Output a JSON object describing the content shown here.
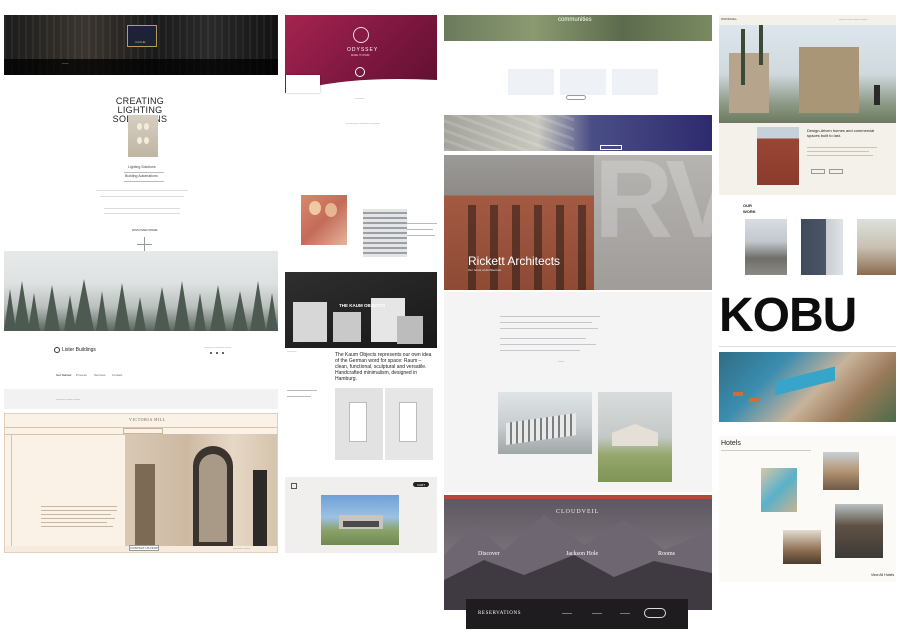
{
  "col1": {
    "cache_label": "CACHE",
    "headline": "CREATING LIGHTING SOLUTIONS",
    "menu": [
      "Lighting Solutions",
      "Building Automations"
    ],
    "discover": "DISCOVER MORE",
    "lister_name": "Lister Buildings",
    "lister_nav": [
      "Get Started",
      "Process",
      "Services",
      "Contact"
    ],
    "victoria_title": "VICTORIA HILL",
    "victoria_btn": "CONTACT US NOW"
  },
  "col2": {
    "odyssey_title": "ODYSSEY",
    "odyssey_sub": "MAKE IT CHAIR",
    "kaum_title": "THE KAUM OBJECTS",
    "kaum_text": "The Kaum Objects represents our own idea of the German word for space: Raum – clean, functional, sculptural and versatile. Handcrafted minimalism, designed in Hamburg.",
    "bottom_btn": "CART"
  },
  "col3": {
    "communities": "communities",
    "rickett_title": "Rickett Architects",
    "rickett_sub": "Our home of Architecture",
    "rv_mark": "RV",
    "cloudveil": "CLOUDVEIL",
    "places": [
      "Discover",
      "Jackson Hole",
      "Rooms"
    ],
    "reservations": "RESERVATIONS"
  },
  "col4": {
    "woodhill": "WOODHILL",
    "headline": "Design-driven homes and commercial spaces built to last.",
    "our_work": "OUR WORK",
    "kobu": "KOBU",
    "hotels": "Hotels",
    "view_all": "View All Hotels"
  },
  "colors": {
    "odyssey": "#8a1b43",
    "rickett_red": "#b35a43",
    "cloudveil": "#6f6970",
    "kobu_pool": "#2e86a8"
  }
}
